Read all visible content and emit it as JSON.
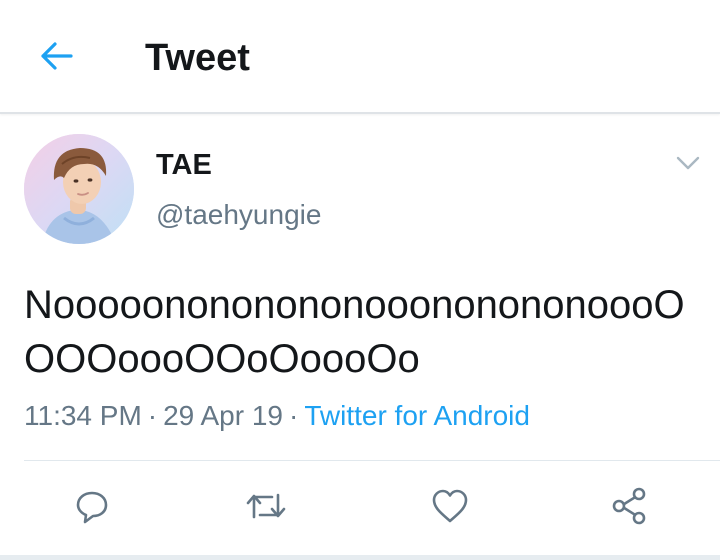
{
  "header": {
    "title": "Tweet",
    "back_icon": "arrow-left-icon",
    "accent": "#1da1f2"
  },
  "author": {
    "name": "TAE",
    "handle": "@taehyungie",
    "avatar_icon": "profile-photo"
  },
  "tweet": {
    "text": "NooooonononononooononononoooOOOOoooOOoOoooOo",
    "time": "11:34 PM",
    "date": "29 Apr 19",
    "separator": "·",
    "client": "Twitter for Android"
  },
  "actions": [
    {
      "name": "reply",
      "icon": "reply-icon"
    },
    {
      "name": "retweet",
      "icon": "retweet-icon"
    },
    {
      "name": "like",
      "icon": "heart-icon"
    },
    {
      "name": "share",
      "icon": "share-icon"
    }
  ],
  "colors": {
    "text": "#14171a",
    "secondary": "#657786",
    "link": "#1da1f2",
    "icon": "#657786",
    "divider": "#e1e8ed"
  }
}
